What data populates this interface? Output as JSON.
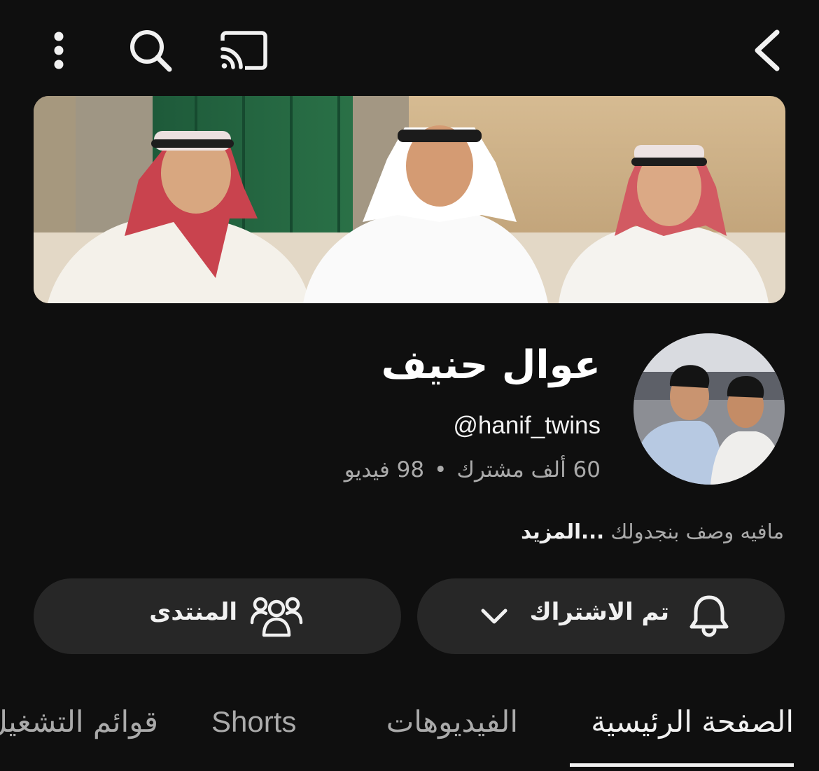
{
  "top_bar": {
    "icons": [
      "more-vert-icon",
      "search-icon",
      "cast-icon",
      "back-chevron-icon"
    ]
  },
  "banner": {
    "image": "channel-banner"
  },
  "channel": {
    "avatar": "channel-avatar",
    "name": "عوال حنيف",
    "handle": "@hanif_twins",
    "subscribers": "60 ألف مشترك",
    "separator": "•",
    "videos": "98 فيديو",
    "description": "مافيه وصف بنجدولك",
    "more_label": "...المزيد"
  },
  "actions": {
    "subscribe_label": "تم الاشتراك",
    "subscribe_icon": "bell-icon",
    "dropdown_icon": "chevron-down-icon",
    "community_label": "المنتدى",
    "community_icon": "people-icon"
  },
  "tabs": [
    {
      "label": "الصفحة الرئيسية",
      "active": true
    },
    {
      "label": "الفيديوهات",
      "active": false
    },
    {
      "label": "Shorts",
      "active": false
    },
    {
      "label": "قوائم التشغيل",
      "active": false
    }
  ],
  "colors": {
    "background": "#0f0f0f",
    "pill": "#272727",
    "text_primary": "#f1f1f1",
    "text_secondary": "#aaaaaa"
  }
}
